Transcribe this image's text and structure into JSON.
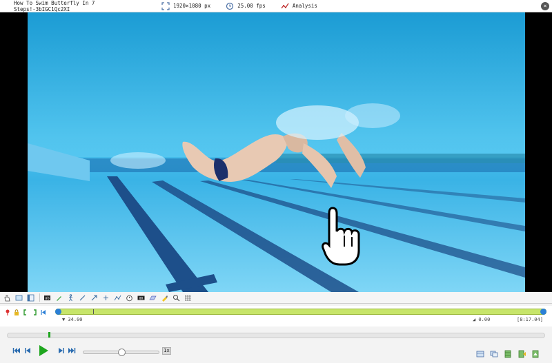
{
  "header": {
    "video_title": "How To Swim Butterfly In 7 Steps!-3bIGC1Qc2XI",
    "resolution": "1920×1080 px",
    "framerate": "25.00 fps",
    "analysis_label": "Analysis",
    "close_glyph": "×"
  },
  "video": {
    "scene": "underwater swimmer in pool lane"
  },
  "toolbar": {
    "tools": [
      "hand-icon",
      "screenshot-icon",
      "panel-icon",
      "grid-icon",
      "pencil-icon",
      "stickman-icon",
      "line-icon",
      "arrow-icon",
      "crosshair-icon",
      "polyline-icon",
      "stopwatch-icon",
      "counter-icon",
      "plane-icon",
      "marker-icon",
      "magnifier-icon",
      "coordinates-icon"
    ]
  },
  "timeline": {
    "start_label": "▼ 34.00",
    "selection_label": "◢ 0.00",
    "end_label": "[8:17.04]"
  },
  "playback": {
    "speed_label": "1x"
  },
  "colors": {
    "accent_green": "#1ea61e",
    "timeline_fill": "#c7e56a",
    "handle_blue": "#2b7fd6"
  }
}
